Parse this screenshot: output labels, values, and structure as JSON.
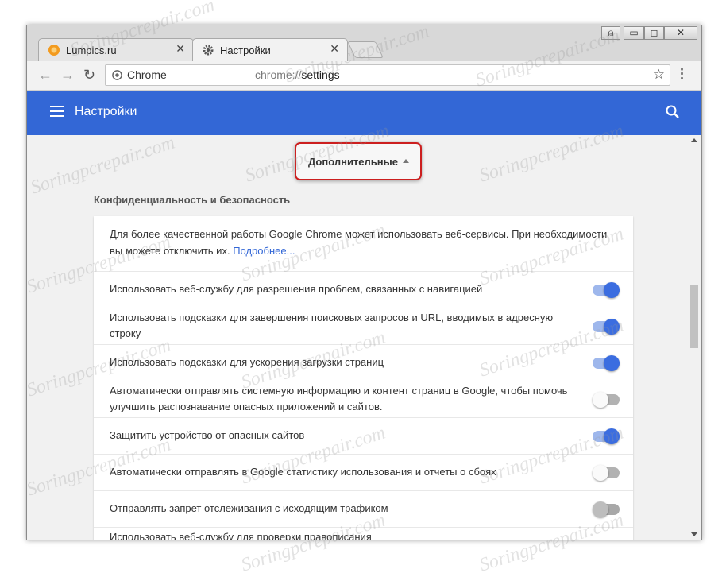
{
  "tabs": [
    {
      "title": "Lumpics.ru",
      "close": "✕",
      "favicon": "orange-favicon"
    },
    {
      "title": "Настройки",
      "close": "✕",
      "favicon": "gear-icon"
    }
  ],
  "window_controls": {
    "user": "⍝",
    "minimize": "▭",
    "restore": "◻",
    "close": "✕"
  },
  "toolbar": {
    "back": "←",
    "forward": "→",
    "reload": "↻",
    "menu": "⋮"
  },
  "omnibox": {
    "chip_label": "Chrome",
    "url_scheme": "chrome://",
    "url_path": "settings",
    "star": "☆"
  },
  "appbar": {
    "title": "Настройки",
    "accent": "#3367d6"
  },
  "advanced": {
    "label": "Дополнительные"
  },
  "section": {
    "title": "Конфиденциальность и безопасность",
    "description": "Для более качественной работы Google Chrome может использовать веб-сервисы. При необходимости вы можете отключить их.",
    "link": "Подробнее..."
  },
  "settings": [
    {
      "label": "Использовать веб-службу для разрешения проблем, связанных с навигацией",
      "state": "on"
    },
    {
      "label": "Использовать подсказки для завершения поисковых запросов и URL, вводимых в адресную строку",
      "state": "on"
    },
    {
      "label": "Использовать подсказки для ускорения загрузки страниц",
      "state": "on"
    },
    {
      "label": "Автоматически отправлять системную информацию и контент страниц в Google, чтобы помочь улучшить распознавание опасных приложений и сайтов.",
      "state": "off"
    },
    {
      "label": "Защитить устройство от опасных сайтов",
      "state": "on"
    },
    {
      "label": "Автоматически отправлять в Google статистику использования и отчеты о сбоях",
      "state": "off"
    },
    {
      "label": "Отправлять запрет отслеживания с исходящим трафиком",
      "state": "disabled"
    },
    {
      "label": "Использовать веб-службу для проверки правописания",
      "state": "off"
    }
  ],
  "watermark": "Soringpcrepair.com"
}
